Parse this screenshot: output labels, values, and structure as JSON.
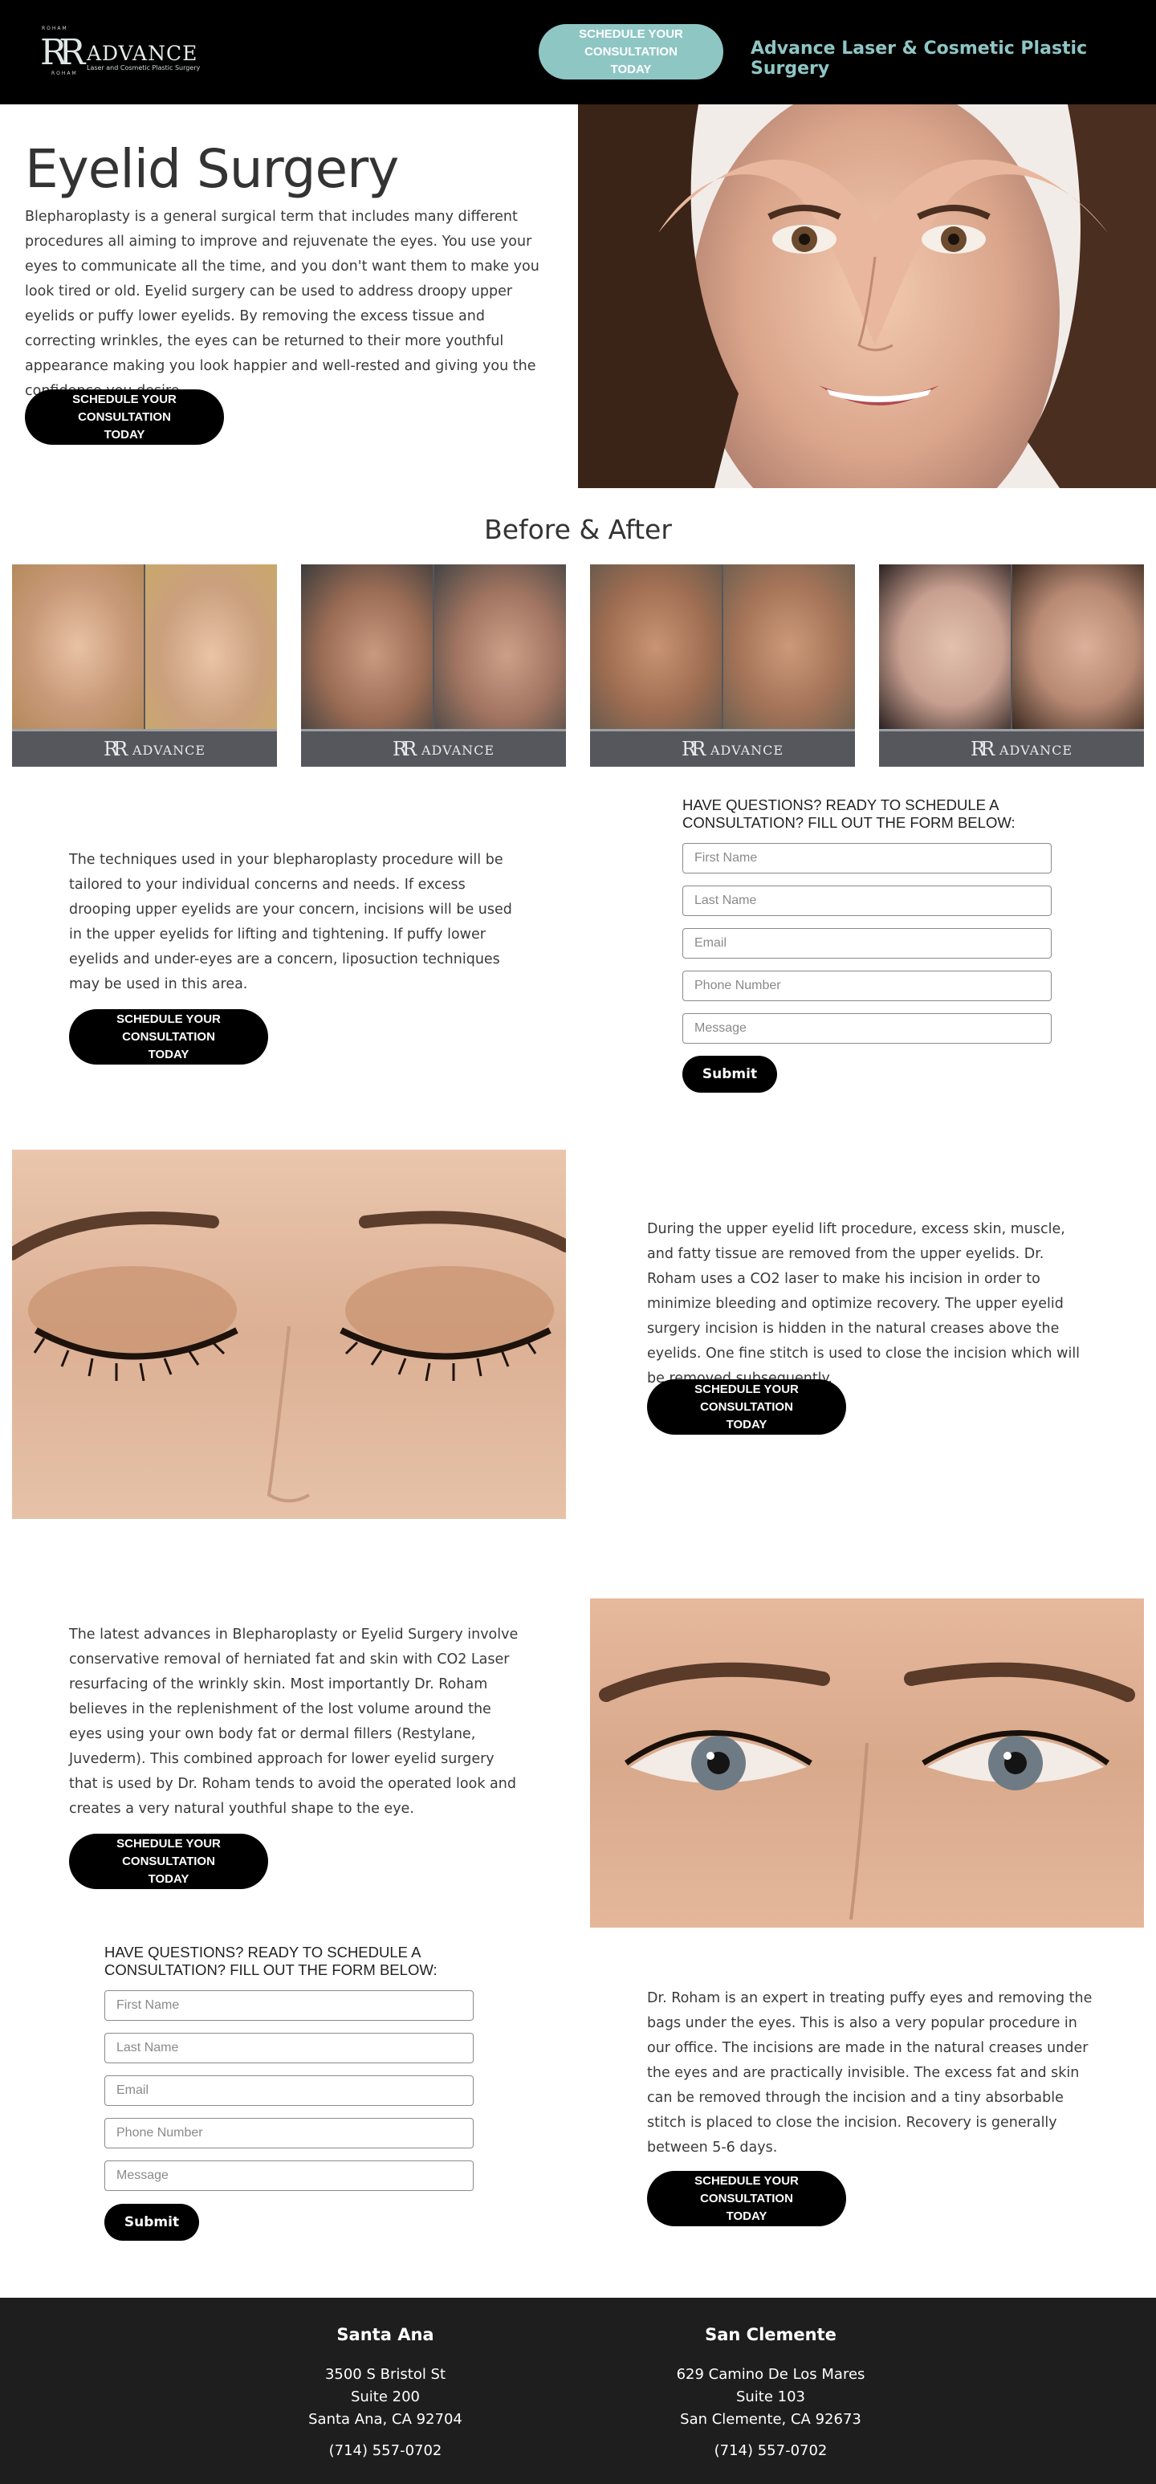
{
  "header": {
    "logo": {
      "monogram": "RR",
      "tiny_top": "ROHAM",
      "tiny_bottom": "ROHAM",
      "word": "ADVANCE",
      "sub": "Laser and Cosmetic Plastic Surgery"
    },
    "cta_label": "SCHEDULE YOUR CONSULTATION TODAY",
    "site_title": "Advance Laser & Cosmetic Plastic Surgery"
  },
  "hero": {
    "title": "Eyelid Surgery",
    "text": "Blepharoplasty is a general surgical term that includes many different procedures all aiming to improve and rejuvenate the eyes. You use your eyes to communicate all the time, and you don't want them to make you look tired or old. Eyelid surgery can be used to address droopy upper eyelids or puffy lower eyelids. By removing the excess tissue and correcting wrinkles, the eyes can be returned to their more youthful appearance making you look happier and well-rested and giving you the confidence you desire.",
    "cta_label": "SCHEDULE YOUR CONSULTATION TODAY"
  },
  "before_after": {
    "title": "Before & After",
    "card_brand": "ADVANCE",
    "card_monogram": "RR"
  },
  "section1": {
    "text": "The techniques used in your blepharoplasty procedure will be tailored to your individual concerns and needs. If excess drooping upper eyelids are your concern, incisions will be used in the upper eyelids for lifting and tightening. If puffy lower eyelids and under-eyes are a concern, liposuction techniques may be used in this area.",
    "cta_label": "SCHEDULE YOUR CONSULTATION TODAY"
  },
  "form1": {
    "title": "HAVE QUESTIONS? READY TO SCHEDULE A CONSULTATION? FILL OUT THE FORM BELOW:",
    "first_name": "First Name",
    "last_name": "Last Name",
    "email": "Email",
    "phone": "Phone Number",
    "message": "Message",
    "submit": "Submit"
  },
  "section2": {
    "text": "During the upper eyelid lift procedure, excess skin, muscle, and fatty tissue are removed from the upper eyelids. Dr. Roham uses a CO2 laser to make his incision in order to minimize bleeding and optimize recovery. The upper eyelid surgery incision is hidden in the natural creases above the eyelids. One fine stitch is used to close the incision which will be removed subsequently.",
    "cta_label": "SCHEDULE YOUR CONSULTATION TODAY"
  },
  "section3": {
    "text": "The latest advances in Blepharoplasty or Eyelid Surgery involve conservative removal of herniated fat and skin with CO2 Laser resurfacing of the wrinkly skin. Most importantly Dr. Roham believes in the replenishment of the lost volume around the eyes using your own body fat or dermal fillers (Restylane, Juvederm). This combined approach for lower eyelid surgery that is used by Dr. Roham tends to avoid the operated look and creates a very natural youthful shape to the eye.",
    "cta_label": "SCHEDULE YOUR CONSULTATION TODAY"
  },
  "form2": {
    "title": "HAVE QUESTIONS? READY TO SCHEDULE A CONSULTATION? FILL OUT THE FORM BELOW:",
    "first_name": "First Name",
    "last_name": "Last Name",
    "email": "Email",
    "phone": "Phone Number",
    "message": "Message",
    "submit": "Submit"
  },
  "section4": {
    "text": "Dr. Roham is an expert in treating puffy eyes and removing the bags under the eyes. This is also a very popular procedure in our office. The incisions are made in the natural creases under the eyes and are practically invisible. The excess fat and skin can be removed through the incision and a tiny absorbable stitch is placed to close the incision. Recovery is generally between 5-6 days.",
    "cta_label": "SCHEDULE YOUR CONSULTATION TODAY"
  },
  "footer": {
    "locations": [
      {
        "name": "Santa Ana",
        "line1": "3500 S Bristol St",
        "line2": "Suite 200",
        "line3": "Santa Ana, CA 92704",
        "phone": "(714) 557-0702"
      },
      {
        "name": "San Clemente",
        "line1": "629 Camino De Los Mares",
        "line2": "Suite 103",
        "line3": "San Clemente, CA 92673",
        "phone": "(714) 557-0702"
      }
    ]
  },
  "colors": {
    "accent": "#8ec6c4",
    "header_bg": "#000000",
    "footer_bg": "#1e1e1e",
    "button_bg": "#000000"
  }
}
